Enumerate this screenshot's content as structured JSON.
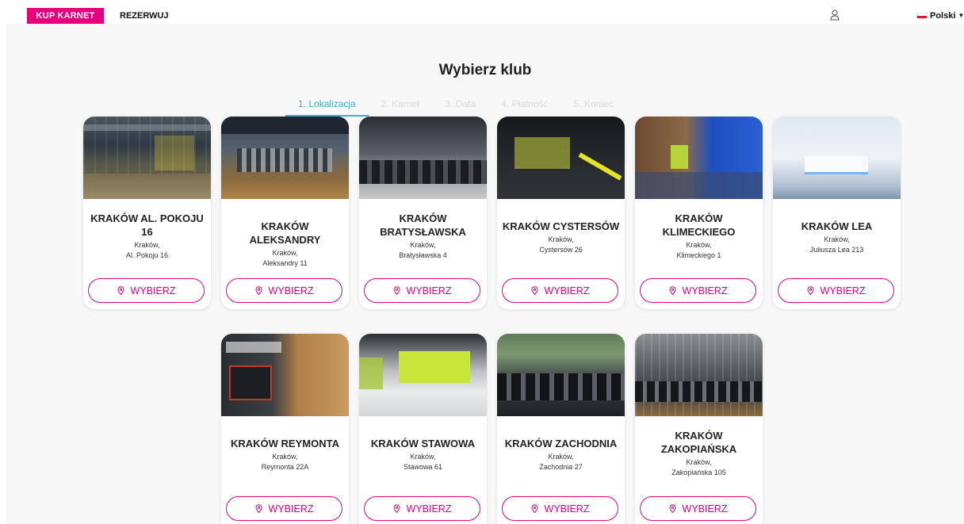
{
  "nav": {
    "buy_label": "KUP KARNET",
    "reserve_label": "REZERWUJ",
    "language_label": "Polski",
    "accent_color": "#e6007e"
  },
  "page_title": "Wybierz klub",
  "steps": [
    {
      "label": "1. Lokalizacja",
      "active": true
    },
    {
      "label": "2. Karnet",
      "active": false
    },
    {
      "label": "3. Data",
      "active": false
    },
    {
      "label": "4. Płatność",
      "active": false
    },
    {
      "label": "5. Koniec",
      "active": false
    }
  ],
  "button_label": "WYBIERZ",
  "clubs": [
    {
      "name": "KRAKÓW AL. POKOJU 16",
      "city": "Kraków,",
      "street": "Al. Pokoju 16"
    },
    {
      "name": "KRAKÓW ALEKSANDRY",
      "city": "Kraków,",
      "street": "Aleksandry 11"
    },
    {
      "name": "KRAKÓW BRATYSŁAWSKA",
      "city": "Kraków,",
      "street": "Bratysławska 4"
    },
    {
      "name": "KRAKÓW CYSTERSÓW",
      "city": "Kraków,",
      "street": "Cystersów 26"
    },
    {
      "name": "KRAKÓW KLIMECKIEGO",
      "city": "Kraków,",
      "street": "Klimeckiego 1"
    },
    {
      "name": "KRAKÓW LEA",
      "city": "Kraków,",
      "street": "Juliusza Lea 213"
    },
    {
      "name": "KRAKÓW REYMONTA",
      "city": "Kraków,",
      "street": "Reymonta 22A"
    },
    {
      "name": "KRAKÓW STAWOWA",
      "city": "Kraków,",
      "street": "Stawowa 61"
    },
    {
      "name": "KRAKÓW ZACHODNIA",
      "city": "Kraków,",
      "street": "Zachodnia 27"
    },
    {
      "name": "KRAKÓW ZAKOPIAŃSKA",
      "city": "Kraków,",
      "street": "Zakopiańska 105"
    }
  ]
}
